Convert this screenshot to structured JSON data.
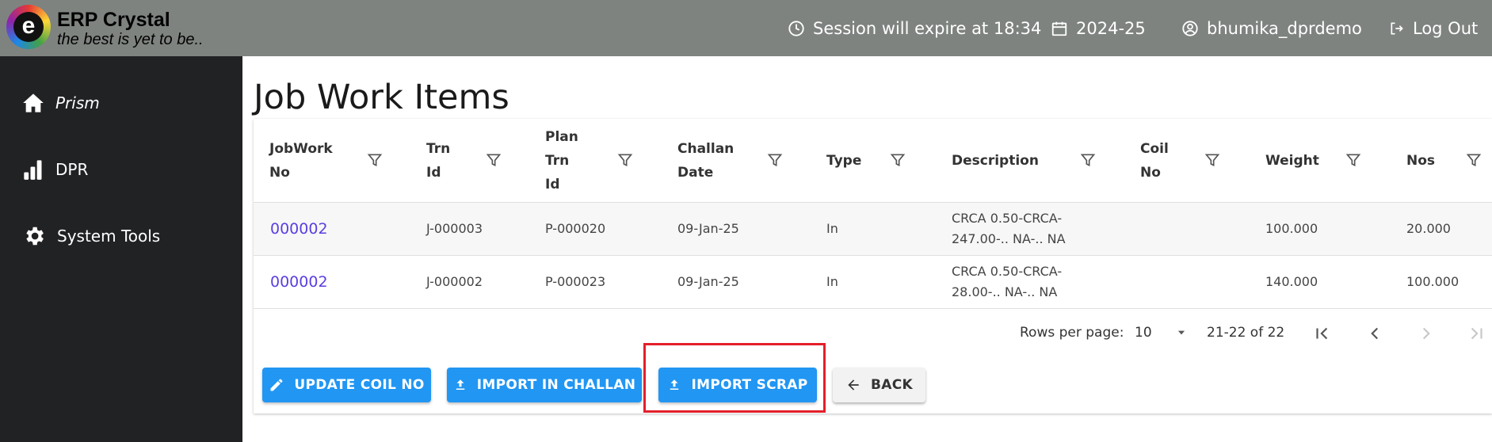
{
  "header": {
    "app_title": "ERP Crystal",
    "tagline": "the best is yet to be..",
    "session": "Session will expire at 18:34",
    "year": "2024-25",
    "user": "bhumika_dprdemo",
    "logout": "Log Out",
    "background_color": "#7f8380"
  },
  "sidebar": {
    "background_color": "#212224",
    "items": [
      {
        "label": "Prism",
        "icon": "home-icon"
      },
      {
        "label": "DPR",
        "icon": "bar-chart-icon"
      },
      {
        "label": "System Tools",
        "icon": "gear-icon"
      }
    ]
  },
  "page": {
    "title": "Job Work Items"
  },
  "table": {
    "columns": [
      {
        "key": "jobwork_no",
        "label": "JobWork\nNo"
      },
      {
        "key": "trn_id",
        "label": "Trn\nId"
      },
      {
        "key": "plan_trn_id",
        "label": "Plan\nTrn\nId"
      },
      {
        "key": "challan_date",
        "label": "Challan\nDate"
      },
      {
        "key": "type",
        "label": "Type"
      },
      {
        "key": "description",
        "label": "Description"
      },
      {
        "key": "coil_no",
        "label": "Coil\nNo"
      },
      {
        "key": "weight",
        "label": "Weight"
      },
      {
        "key": "nos",
        "label": "Nos"
      }
    ],
    "rows": [
      {
        "jobwork_no": "000002",
        "trn_id": "J-000003",
        "plan_trn_id": "P-000020",
        "challan_date": "09-Jan-25",
        "type": "In",
        "description": "CRCA 0.50-CRCA-\n247.00-.. NA-.. NA",
        "coil_no": "",
        "weight": "100.000",
        "nos": "20.000"
      },
      {
        "jobwork_no": "000002",
        "trn_id": "J-000002",
        "plan_trn_id": "P-000023",
        "challan_date": "09-Jan-25",
        "type": "In",
        "description": "CRCA 0.50-CRCA-\n28.00-.. NA-.. NA",
        "coil_no": "",
        "weight": "140.000",
        "nos": "100.000"
      }
    ],
    "link_color": "#5b3ee0"
  },
  "pagination": {
    "rows_per_page_label": "Rows per page:",
    "rows_per_page_value": "10",
    "range": "21-22 of 22"
  },
  "actions": {
    "update_coil": "UPDATE COIL NO",
    "import_challan": "IMPORT IN CHALLAN",
    "import_scrap": "IMPORT SCRAP",
    "back": "BACK",
    "primary_color": "#2196f3",
    "highlight_color": "#e3202a"
  }
}
